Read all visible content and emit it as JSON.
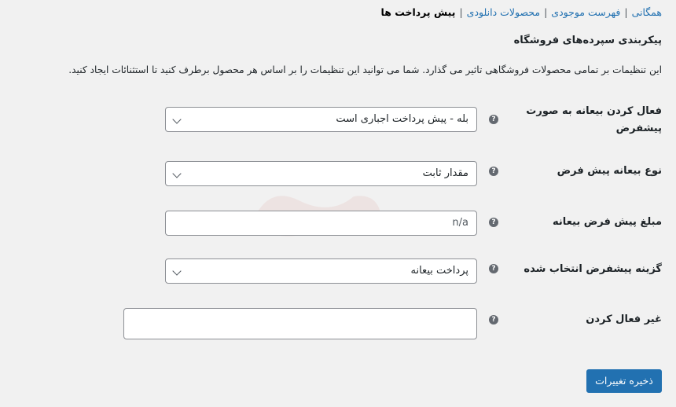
{
  "subnav": {
    "items": [
      {
        "label": "همگانی",
        "current": false
      },
      {
        "label": "فهرست موجودی",
        "current": false
      },
      {
        "label": "محصولات دانلودی",
        "current": false
      },
      {
        "label": "پیش پرداخت ها",
        "current": true
      }
    ],
    "separator": "|"
  },
  "section": {
    "title": "پیکربندی سپرده‌های فروشگاه",
    "description": "این تنظیمات بر تمامی محصولات فروشگاهی تاثیر می گذارد. شما می توانید این تنظیمات را بر اساس هر محصول برطرف کنید تا استثنائات ایجاد کنید."
  },
  "fields": [
    {
      "label": "فعال کردن بیعانه به صورت پیشفرض",
      "type": "select",
      "value": "بله - پیش پرداخت اجباری است"
    },
    {
      "label": "نوع بیعانه پیش فرض",
      "type": "select",
      "value": "مقدار ثابت"
    },
    {
      "label": "مبلغ پیش فرض بیعانه",
      "type": "text",
      "value": "n/a"
    },
    {
      "label": "گزینه پیشفرض انتخاب شده",
      "type": "select",
      "value": "پرداخت بیعانه"
    },
    {
      "label": "غیر فعال کردن",
      "type": "textarea",
      "value": ""
    }
  ],
  "help_icon": {
    "glyph": "?",
    "icon": "question-mark-circle-icon"
  },
  "save_button": {
    "label": "ذخیره تغییرات"
  },
  "colors": {
    "accent": "#2271b1",
    "background": "#f1f1f1"
  }
}
